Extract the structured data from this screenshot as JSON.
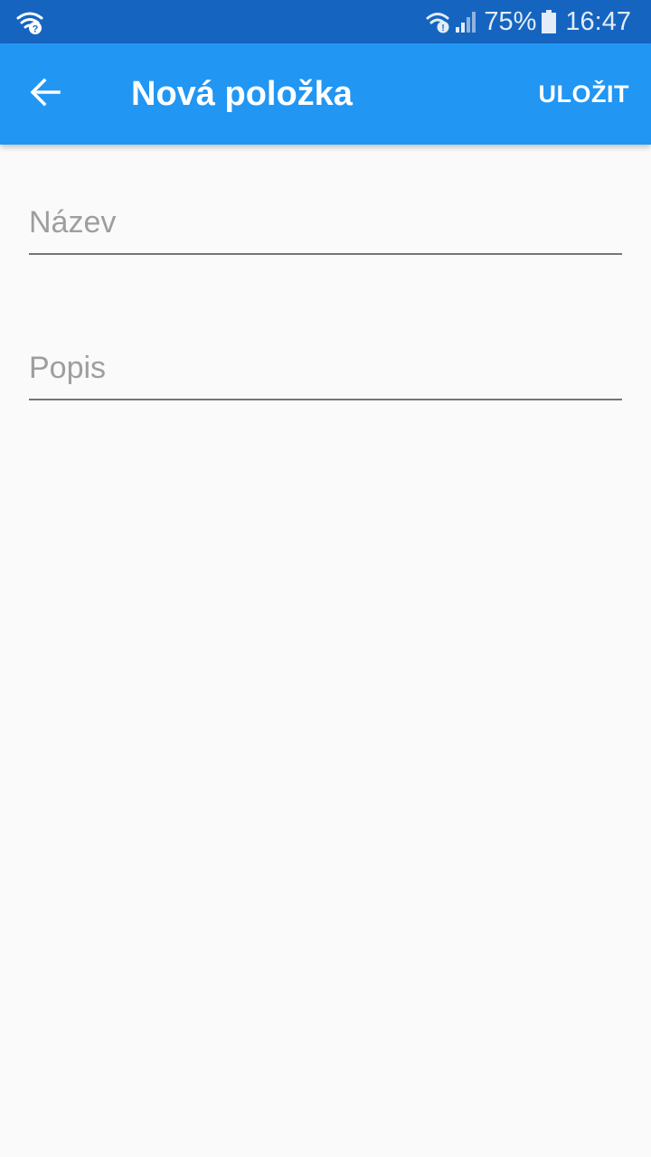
{
  "status_bar": {
    "battery_percent": "75%",
    "time": "16:47",
    "icons": [
      "wifi-question-icon",
      "wifi-question-icon",
      "signal-icon",
      "battery-icon"
    ]
  },
  "app_bar": {
    "title": "Nová položka",
    "save_label": "ULOŽIT",
    "back_icon": "arrow-back-icon",
    "color": "#2196f3"
  },
  "form": {
    "name_placeholder": "Název",
    "name_value": "",
    "description_placeholder": "Popis",
    "description_value": ""
  },
  "colors": {
    "status_bar": "#1565c0",
    "app_bar": "#2196f3",
    "background": "#fafafa",
    "underline": "#757575",
    "placeholder": "#9e9e9e"
  }
}
